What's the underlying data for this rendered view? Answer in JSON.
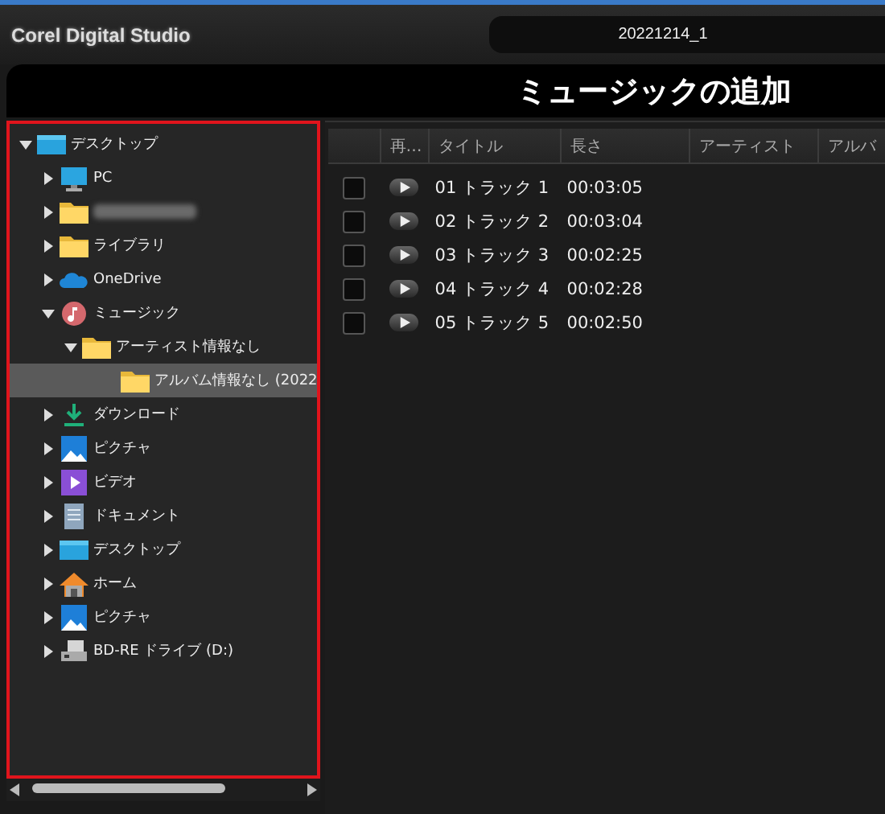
{
  "app_title": "Corel Digital Studio",
  "project_name": "20221214_1",
  "page_title": "ミュージックの追加",
  "tree": [
    {
      "label": "デスクトップ",
      "kind": "desktop",
      "expanded": true,
      "selected": false,
      "children": [
        {
          "label": "PC",
          "kind": "pc",
          "expanded": false,
          "selected": false
        },
        {
          "kind": "folder",
          "blurred": true,
          "expanded": false,
          "selected": false
        },
        {
          "label": "ライブラリ",
          "kind": "folder",
          "expanded": false,
          "selected": false
        },
        {
          "label": "OneDrive",
          "kind": "cloud",
          "expanded": false,
          "selected": false
        },
        {
          "label": "ミュージック",
          "kind": "music",
          "expanded": true,
          "selected": false,
          "children": [
            {
              "label": "アーティスト情報なし",
              "kind": "folder",
              "expanded": true,
              "selected": false,
              "children": [
                {
                  "label": "アルバム情報なし (2022",
                  "kind": "folder",
                  "leaf": true,
                  "selected": true
                }
              ]
            }
          ]
        },
        {
          "label": "ダウンロード",
          "kind": "download",
          "expanded": false,
          "selected": false
        },
        {
          "label": "ピクチャ",
          "kind": "pictures",
          "expanded": false,
          "selected": false
        },
        {
          "label": "ビデオ",
          "kind": "video",
          "expanded": false,
          "selected": false
        },
        {
          "label": "ドキュメント",
          "kind": "document",
          "expanded": false,
          "selected": false
        },
        {
          "label": "デスクトップ",
          "kind": "desktop",
          "expanded": false,
          "selected": false
        },
        {
          "label": "ホーム",
          "kind": "home",
          "expanded": false,
          "selected": false
        },
        {
          "label": "ピクチャ",
          "kind": "pictures",
          "expanded": false,
          "selected": false
        },
        {
          "label": "BD-RE ドライブ (D:)",
          "kind": "drive",
          "expanded": false,
          "selected": false
        }
      ]
    }
  ],
  "table": {
    "columns": [
      "再…",
      "タイトル",
      "長さ",
      "アーティスト",
      "アルバ"
    ],
    "rows": [
      {
        "checked": false,
        "title": "01 トラック 1",
        "length": "00:03:05"
      },
      {
        "checked": false,
        "title": "02 トラック 2",
        "length": "00:03:04"
      },
      {
        "checked": false,
        "title": "03 トラック 3",
        "length": "00:02:25"
      },
      {
        "checked": false,
        "title": "04 トラック 4",
        "length": "00:02:28"
      },
      {
        "checked": false,
        "title": "05 トラック 5",
        "length": "00:02:50"
      }
    ]
  }
}
